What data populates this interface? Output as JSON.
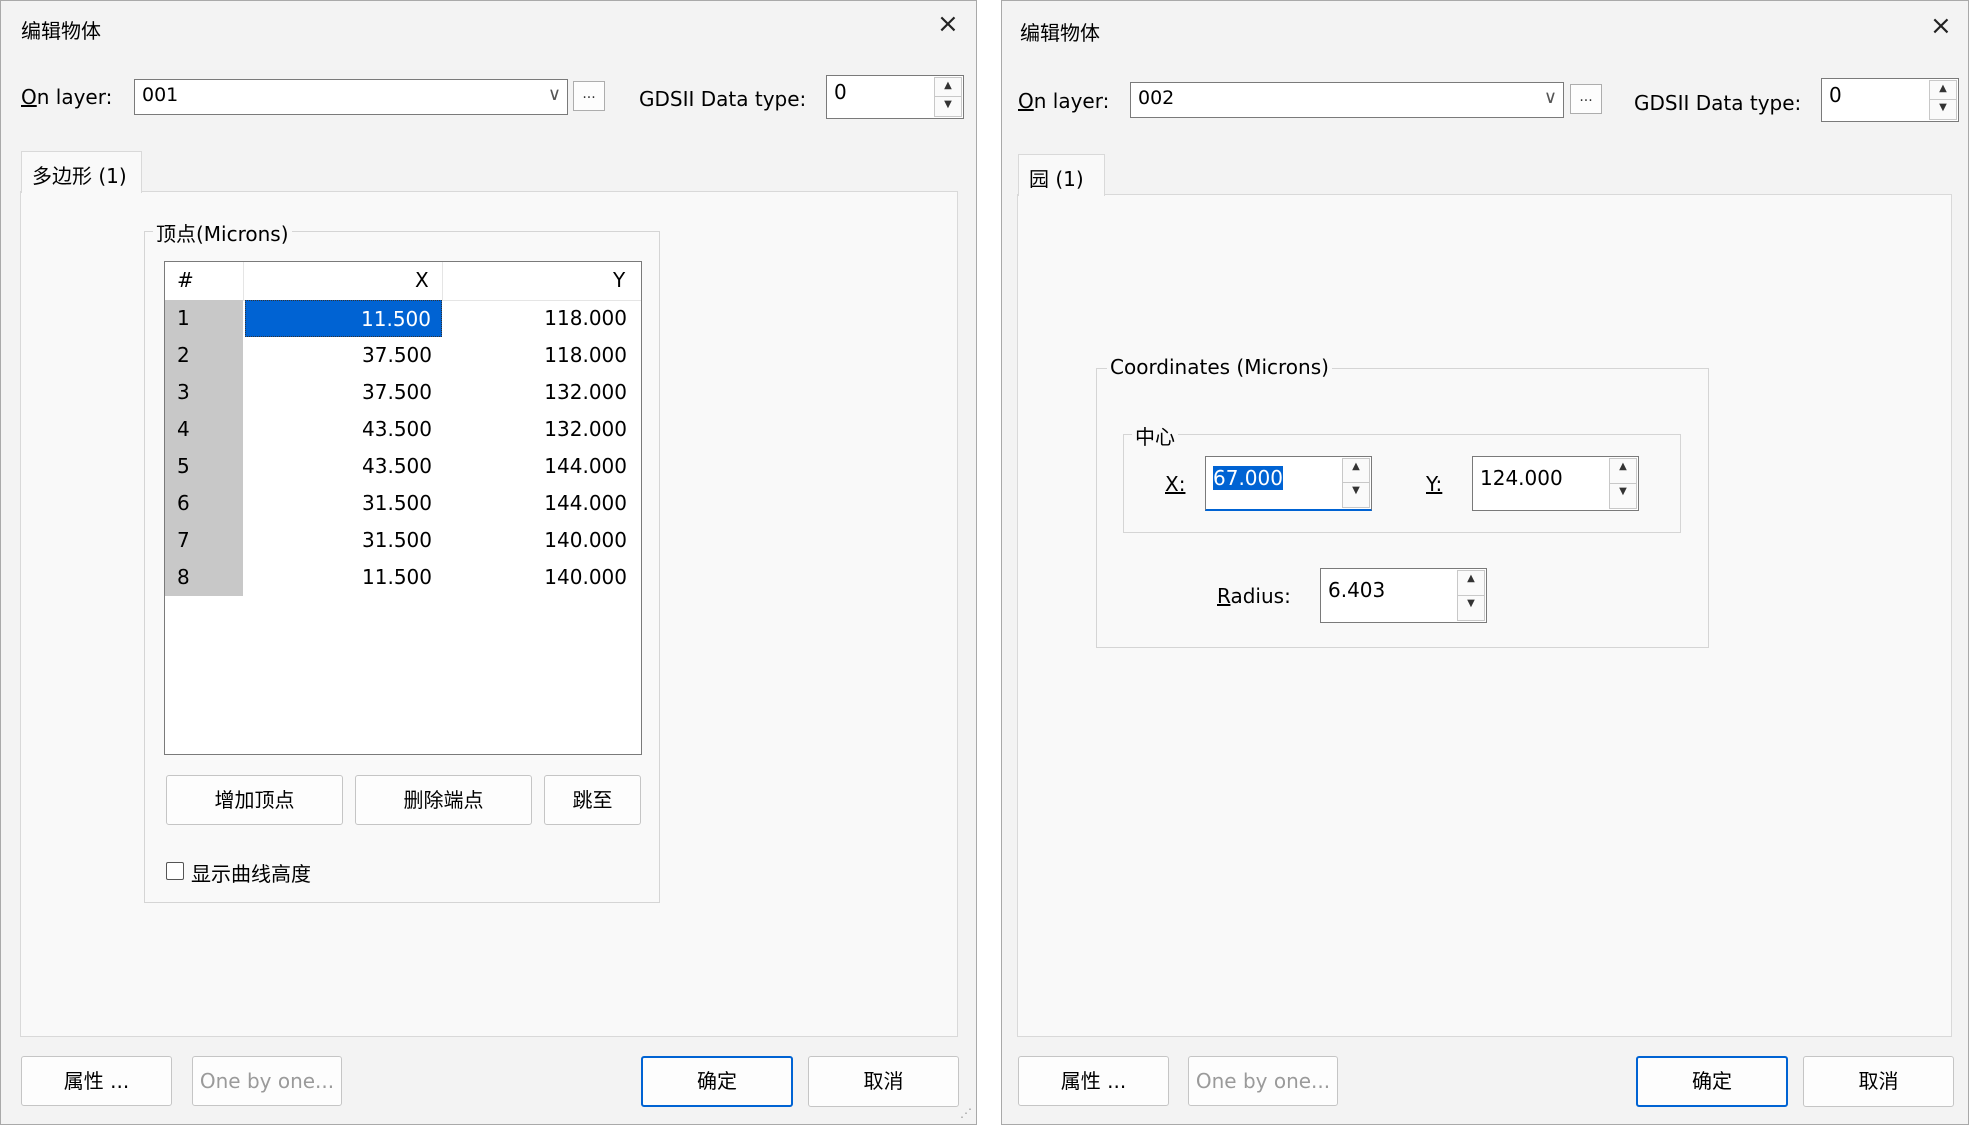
{
  "dialog1": {
    "title": "编辑物体",
    "on_layer_label_first": "O",
    "on_layer_label_rest": "n layer:",
    "layer_value": "001",
    "dots_label": "...",
    "gds_label": "GDSII Data type:",
    "gds_value": "0",
    "tab_label": "多边形 (1)",
    "group_title": "顶点(Microns)",
    "columns": [
      "#",
      "X",
      "Y"
    ],
    "rows": [
      {
        "n": "1",
        "x": "11.500",
        "y": "118.000"
      },
      {
        "n": "2",
        "x": "37.500",
        "y": "118.000"
      },
      {
        "n": "3",
        "x": "37.500",
        "y": "132.000"
      },
      {
        "n": "4",
        "x": "43.500",
        "y": "132.000"
      },
      {
        "n": "5",
        "x": "43.500",
        "y": "144.000"
      },
      {
        "n": "6",
        "x": "31.500",
        "y": "144.000"
      },
      {
        "n": "7",
        "x": "31.500",
        "y": "140.000"
      },
      {
        "n": "8",
        "x": "11.500",
        "y": "140.000"
      }
    ],
    "add_vertex": "增加顶点",
    "delete_vertex": "删除端点",
    "goto": "跳至",
    "show_curve": "显示曲线高度",
    "properties": "属性 ...",
    "one_by_one": "One by one...",
    "ok": "确定",
    "cancel": "取消"
  },
  "dialog2": {
    "title": "编辑物体",
    "on_layer_label_first": "O",
    "on_layer_label_rest": "n layer:",
    "layer_value": "002",
    "dots_label": "...",
    "gds_label": "GDSII Data type:",
    "gds_value": "0",
    "tab_label": "园 (1)",
    "coords_title": "Coordinates (Microns)",
    "center_title": "中心",
    "x_label": "X:",
    "x_value": "67.000",
    "y_label": "Y:",
    "y_value": "124.000",
    "radius_label_first": "R",
    "radius_label_rest": "adius:",
    "radius_value": "6.403",
    "properties": "属性 ...",
    "one_by_one": "One by one...",
    "ok": "确定",
    "cancel": "取消"
  },
  "icons": {
    "close": "×",
    "chevron": "∨",
    "up": "▲",
    "down": "▼"
  },
  "colors": {
    "selection": "#0063d3",
    "dialog_bg": "#f3f3f3",
    "row_header": "#c8c8c8"
  }
}
